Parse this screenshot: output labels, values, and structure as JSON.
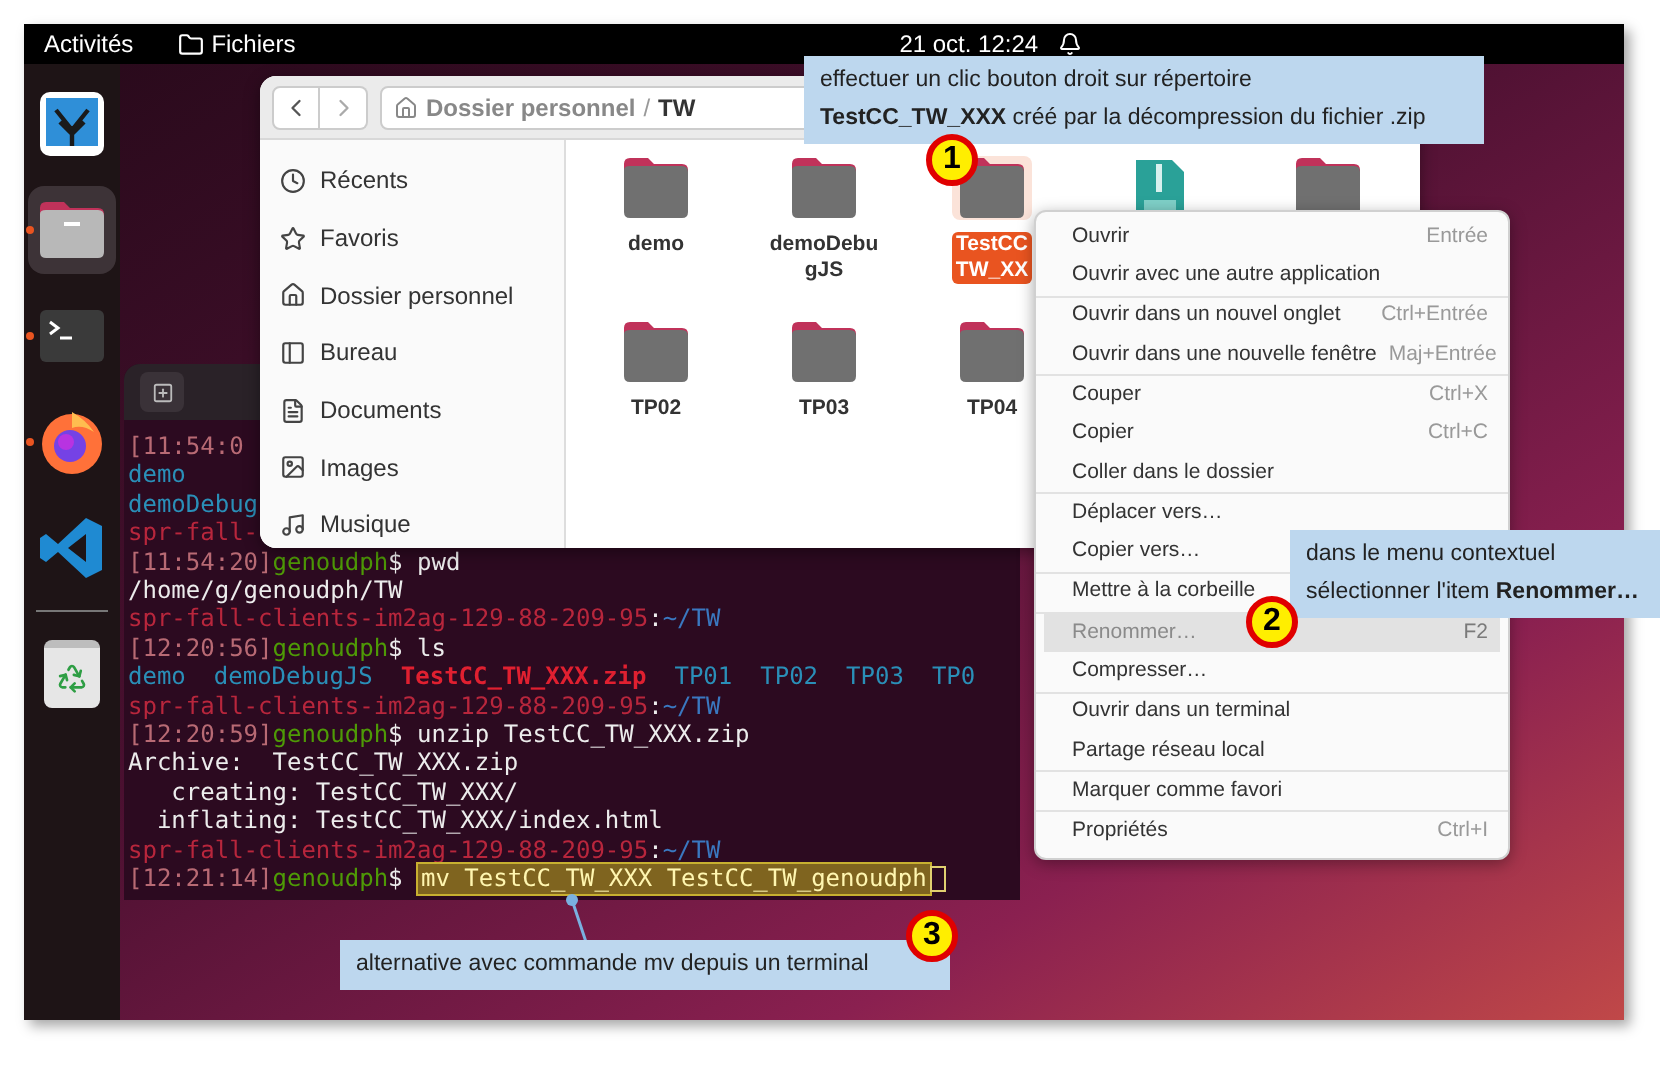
{
  "top_bar": {
    "activities": "Activités",
    "app_name": "Fichiers",
    "clock": "21 oct. 12:24"
  },
  "dock": [
    {
      "kind": "photos",
      "running": false,
      "selected": false
    },
    {
      "kind": "files",
      "running": true,
      "selected": true
    },
    {
      "kind": "terminal",
      "running": true,
      "selected": false
    },
    {
      "kind": "firefox",
      "running": true,
      "selected": false
    },
    {
      "kind": "code",
      "running": false,
      "selected": false
    },
    {
      "kind": "trash",
      "running": false,
      "selected": false
    }
  ],
  "terminal": {
    "lines": [
      {
        "kind": "output",
        "highlighted": false,
        "segments": [
          {
            "kind": "time",
            "text": "[11:54:0"
          }
        ]
      },
      {
        "kind": "output",
        "highlighted": false,
        "segments": [
          {
            "kind": "dir",
            "text": "demo"
          }
        ]
      },
      {
        "kind": "output",
        "highlighted": false,
        "segments": [
          {
            "kind": "dir",
            "text": "demoDebug"
          }
        ]
      },
      {
        "kind": "output",
        "highlighted": false,
        "segments": [
          {
            "kind": "host",
            "text": "spr-fall-"
          }
        ]
      },
      {
        "kind": "output",
        "highlighted": false,
        "segments": [
          {
            "kind": "time",
            "text": "[11:54:20]"
          },
          {
            "kind": "user",
            "text": "genoudph"
          },
          {
            "kind": "text",
            "text": "$ pwd"
          }
        ]
      },
      {
        "kind": "output",
        "highlighted": false,
        "segments": [
          {
            "kind": "text",
            "text": "/home/g/genoudph/TW"
          }
        ]
      },
      {
        "kind": "output",
        "highlighted": false,
        "segments": [
          {
            "kind": "host",
            "text": "spr-fall-clients-im2ag-129-88-209-95"
          },
          {
            "kind": "text",
            "text": ":"
          },
          {
            "kind": "path",
            "text": "~/TW"
          }
        ]
      },
      {
        "kind": "output",
        "highlighted": false,
        "segments": [
          {
            "kind": "time",
            "text": "[12:20:56]"
          },
          {
            "kind": "user",
            "text": "genoudph"
          },
          {
            "kind": "text",
            "text": "$ ls"
          }
        ]
      },
      {
        "kind": "listing",
        "highlighted": false,
        "segments": [
          {
            "kind": "dir",
            "text": "demo"
          },
          {
            "kind": "dir",
            "text": "demoDebugJS"
          },
          {
            "kind": "archive",
            "text": "TestCC_TW_XXX.zip"
          },
          {
            "kind": "dir",
            "text": "TP01"
          },
          {
            "kind": "dir",
            "text": "TP02"
          },
          {
            "kind": "dir",
            "text": "TP03"
          },
          {
            "kind": "dir",
            "text": "TP0"
          }
        ]
      },
      {
        "kind": "output",
        "highlighted": false,
        "segments": [
          {
            "kind": "host",
            "text": "spr-fall-clients-im2ag-129-88-209-95"
          },
          {
            "kind": "text",
            "text": ":"
          },
          {
            "kind": "path",
            "text": "~/TW"
          }
        ]
      },
      {
        "kind": "output",
        "highlighted": false,
        "segments": [
          {
            "kind": "time",
            "text": "[12:20:59]"
          },
          {
            "kind": "user",
            "text": "genoudph"
          },
          {
            "kind": "text",
            "text": "$ unzip TestCC_TW_XXX.zip"
          }
        ]
      },
      {
        "kind": "output",
        "highlighted": false,
        "segments": [
          {
            "kind": "text",
            "text": "Archive:  TestCC_TW_XXX.zip"
          }
        ]
      },
      {
        "kind": "output",
        "highlighted": false,
        "segments": [
          {
            "kind": "text",
            "text": "   creating: TestCC_TW_XXX/"
          }
        ]
      },
      {
        "kind": "output",
        "highlighted": false,
        "segments": [
          {
            "kind": "text",
            "text": "  inflating: TestCC_TW_XXX/index.html"
          }
        ]
      },
      {
        "kind": "output",
        "highlighted": false,
        "segments": [
          {
            "kind": "host",
            "text": "spr-fall-clients-im2ag-129-88-209-95"
          },
          {
            "kind": "text",
            "text": ":"
          },
          {
            "kind": "path",
            "text": "~/TW"
          }
        ]
      },
      {
        "kind": "output",
        "highlighted": true,
        "segments": [
          {
            "kind": "time",
            "text": "[12:21:14]"
          },
          {
            "kind": "user",
            "text": "genoudph"
          },
          {
            "kind": "text",
            "text": "$ "
          },
          {
            "kind": "text",
            "text": "mv TestCC_TW_XXX TestCC_TW_genoudph"
          }
        ]
      }
    ]
  },
  "file_manager": {
    "path": [
      "Dossier personnel",
      "TW"
    ],
    "path_separator": "/",
    "sidebar": [
      {
        "kind": "recent",
        "label": "Récents"
      },
      {
        "kind": "starred",
        "label": "Favoris"
      },
      {
        "kind": "home",
        "label": "Dossier personnel"
      },
      {
        "kind": "desktop",
        "label": "Bureau"
      },
      {
        "kind": "documents",
        "label": "Documents"
      },
      {
        "kind": "pictures",
        "label": "Images"
      },
      {
        "kind": "music",
        "label": "Musique"
      }
    ],
    "files": [
      {
        "kind": "folder",
        "name": "demo",
        "selected": false
      },
      {
        "kind": "folder",
        "name": "demoDebugJS",
        "selected": false
      },
      {
        "kind": "folder",
        "name": "TestCC TW_XX",
        "selected": true
      },
      {
        "kind": "zip",
        "selected": false
      },
      {
        "kind": "folder",
        "selected": false
      },
      {
        "kind": "folder",
        "name": "TP02",
        "selected": false
      },
      {
        "kind": "folder",
        "name": "TP03",
        "selected": false
      },
      {
        "kind": "folder",
        "name": "TP04",
        "selected": false
      }
    ]
  },
  "context_menu": {
    "sections": [
      [
        {
          "label": "Ouvrir",
          "shortcut": "Entrée",
          "disabled": false,
          "selected": false
        },
        {
          "label": "Ouvrir avec une autre application",
          "disabled": false,
          "selected": false
        }
      ],
      [
        {
          "label": "Ouvrir dans un nouvel onglet",
          "shortcut": "Ctrl+Entrée",
          "disabled": false,
          "selected": false
        },
        {
          "label": "Ouvrir dans une nouvelle fenêtre",
          "shortcut": "Maj+Entrée",
          "disabled": false,
          "selected": false
        }
      ],
      [
        {
          "label": "Couper",
          "shortcut": "Ctrl+X",
          "disabled": false,
          "selected": false
        },
        {
          "label": "Copier",
          "shortcut": "Ctrl+C",
          "disabled": false,
          "selected": false
        },
        {
          "label": "Coller dans le dossier",
          "disabled": false,
          "selected": false
        }
      ],
      [
        {
          "label": "Déplacer vers…",
          "disabled": false,
          "selected": false
        },
        {
          "label": "Copier vers…",
          "disabled": false,
          "selected": false
        }
      ],
      [
        {
          "label": "Mettre à la corbeille",
          "disabled": false,
          "selected": false
        }
      ],
      [
        {
          "label": "Renommer…",
          "shortcut": "F2",
          "disabled": true,
          "selected": true
        },
        {
          "label": "Compresser…",
          "disabled": false,
          "selected": false
        }
      ],
      [
        {
          "label": "Ouvrir dans un terminal",
          "disabled": false,
          "selected": false
        },
        {
          "label": "Partage réseau local",
          "disabled": false,
          "selected": false
        }
      ],
      [
        {
          "label": "Marquer comme favori",
          "disabled": false,
          "selected": false
        }
      ],
      [
        {
          "label": "Propriétés",
          "shortcut": "Ctrl+I",
          "disabled": false,
          "selected": false
        }
      ]
    ]
  },
  "callouts": [
    {
      "number": "1",
      "lines": [
        "effectuer un clic bouton droit sur répertoire",
        "**TestCC_TW_XXX** créé par la décompression du fichier .zip"
      ]
    },
    {
      "number": "2",
      "lines": [
        "dans le menu contextuel",
        "sélectionner l'item **Renommer…**"
      ]
    },
    {
      "number": "3",
      "lines": [
        "alternative avec commande mv depuis un terminal"
      ]
    }
  ]
}
